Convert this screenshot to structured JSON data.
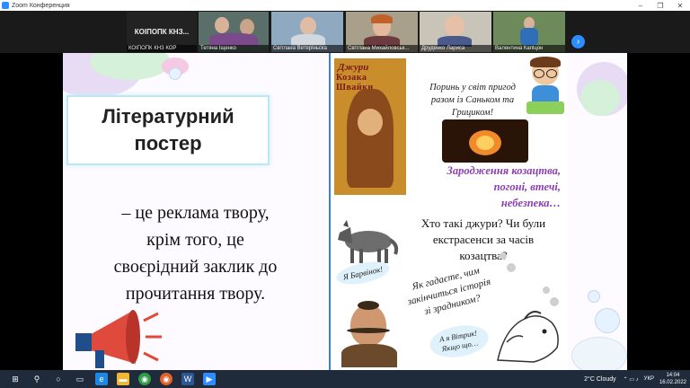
{
  "window": {
    "title": "Zoom Конференция",
    "minimize": "–",
    "maximize": "❐",
    "close": "✕"
  },
  "participants": [
    {
      "name": "КОІПОПК КНЗ КОР",
      "display": "КОІПОПК КНЗ..."
    },
    {
      "name": "Тетяна Іщенко"
    },
    {
      "name": "Світлана Ветеріньска"
    },
    {
      "name": "Світлана Михайловськ..."
    },
    {
      "name": "Друденко Лариса"
    },
    {
      "name": "Валентина Капіцон"
    }
  ],
  "slide": {
    "title_line1": "Літературний",
    "title_line2": "постер",
    "body_lines": [
      "– це реклама твору,",
      "крім того, це",
      "своєрідний заклик до",
      "прочитання твору."
    ],
    "poster": {
      "book_title1": "Джури",
      "book_title2": "Козака Швайки",
      "intro": [
        "Поринь у світ пригод",
        "разом із Саньком та",
        "Грициком!"
      ],
      "purple": [
        "Зародження козацтва,",
        "погоні, втечі,",
        "небезпека…"
      ],
      "question": [
        "Хто такі джури? Чи були",
        "екстрасенси за часів",
        "козацтва?"
      ],
      "cloud1": "Я Барвінок!",
      "guess": [
        "Як гадаєте, чим",
        "закінчиться історія",
        "зі зрадником?"
      ],
      "cloud2": [
        "А я Вітрик!",
        "Якщо що…"
      ]
    }
  },
  "taskbar": {
    "weather": "2°C  Cloudy",
    "lang": "УКР",
    "time": "14:04",
    "date": "16.02.2022"
  },
  "colors": {
    "zoom_blue": "#2d8cff",
    "poster_border": "#3c7fd8",
    "purple_text": "#8b3fb0",
    "taskbar": "#1f2a3a"
  }
}
